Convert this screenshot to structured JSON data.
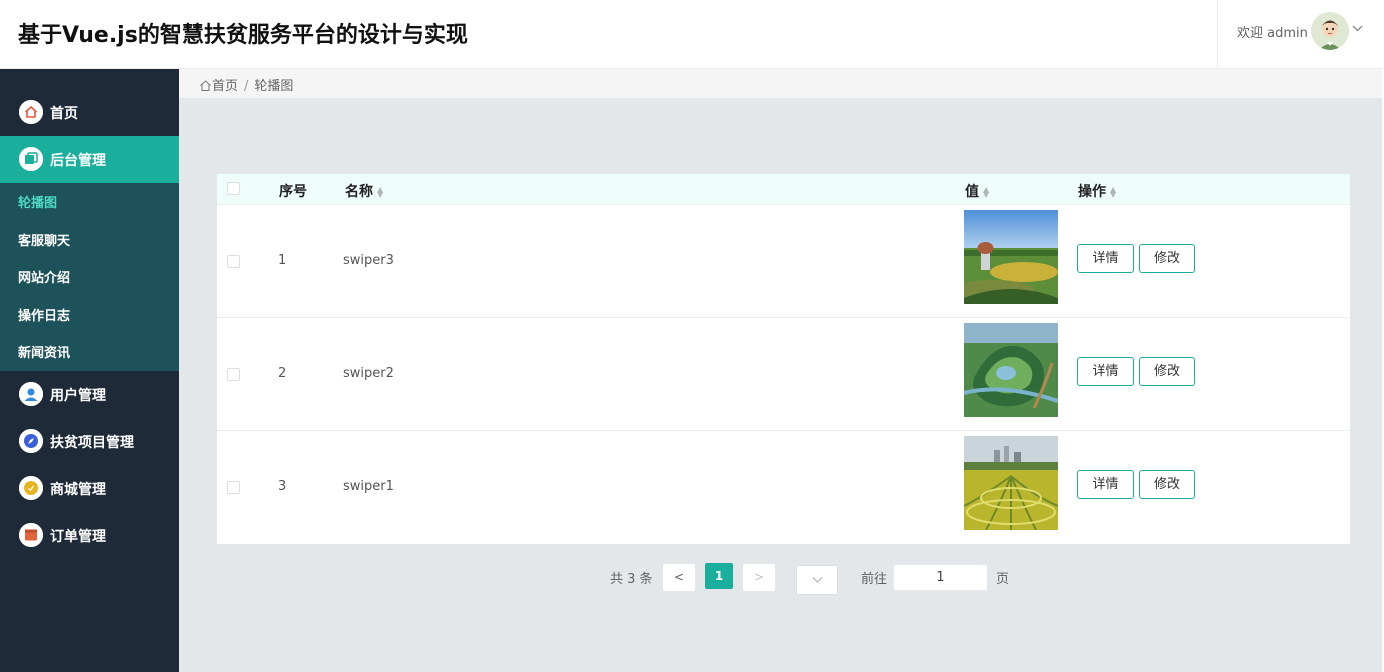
{
  "header": {
    "title": "基于Vue.js的智慧扶贫服务平台的设计与实现",
    "welcome": "欢迎 admin"
  },
  "sidebar": {
    "items": [
      {
        "label": "首页",
        "icon": "home-icon",
        "color": "#e8563c"
      },
      {
        "label": "后台管理",
        "icon": "copy-icon",
        "color": "#1aaf9c",
        "active": true
      },
      {
        "label": "用户管理",
        "icon": "user-icon",
        "color": "#2f8ae0"
      },
      {
        "label": "扶贫项目管理",
        "icon": "compass-icon",
        "color": "#3a5fd9"
      },
      {
        "label": "商城管理",
        "icon": "coin-icon",
        "color": "#e6b422"
      },
      {
        "label": "订单管理",
        "icon": "box-icon",
        "color": "#e2643a"
      }
    ],
    "submenu": [
      "轮播图",
      "客服聊天",
      "网站介绍",
      "操作日志",
      "新闻资讯"
    ]
  },
  "breadcrumb": {
    "home": "首页",
    "current": "轮播图"
  },
  "table": {
    "columns": [
      "序号",
      "名称",
      "值",
      "操作"
    ],
    "rows": [
      {
        "index": "1",
        "name": "swiper3"
      },
      {
        "index": "2",
        "name": "swiper2"
      },
      {
        "index": "3",
        "name": "swiper1"
      }
    ],
    "detail_label": "详情",
    "edit_label": "修改"
  },
  "pagination": {
    "total": "共 3 条",
    "prev": "<",
    "current_page": "1",
    "next": ">",
    "goto_label": "前往",
    "goto_value": "1",
    "page_suffix": "页"
  },
  "colors": {
    "accent": "#1aaf9c",
    "sidebar_bg": "#1e2a38",
    "submenu_bg": "#1e525a"
  }
}
